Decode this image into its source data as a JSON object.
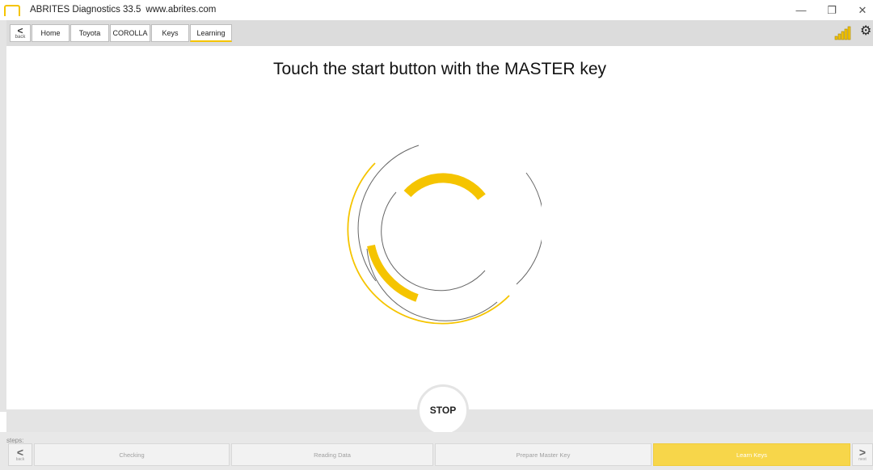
{
  "window": {
    "title": "ABRITES Diagnostics 33.5",
    "url": "www.abrites.com",
    "controls": {
      "minimize": "—",
      "maximize": "❐",
      "close": "✕"
    }
  },
  "toolbar": {
    "back_label": "back",
    "back_glyph": "<",
    "breadcrumbs": [
      "Home",
      "Toyota",
      "COROLLA",
      "Keys",
      "Learning"
    ],
    "icons": [
      "signal-strength-icon",
      "gear-icon"
    ],
    "gear_glyph": "⚙"
  },
  "main": {
    "instruction": "Touch the start button with the MASTER key",
    "stop_label": "STOP"
  },
  "steps": {
    "label": "steps:",
    "prev_label": "back",
    "prev_glyph": "<",
    "next_label": "next",
    "next_glyph": ">",
    "items": [
      "Checking",
      "Reading Data",
      "Prepare Master Key",
      "Learn Keys"
    ],
    "active_index": 3
  },
  "colors": {
    "accent": "#f5c400",
    "active_step": "#f7d64a",
    "toolbar_bg": "#dcdcdc",
    "spinner_gray": "#555555"
  }
}
